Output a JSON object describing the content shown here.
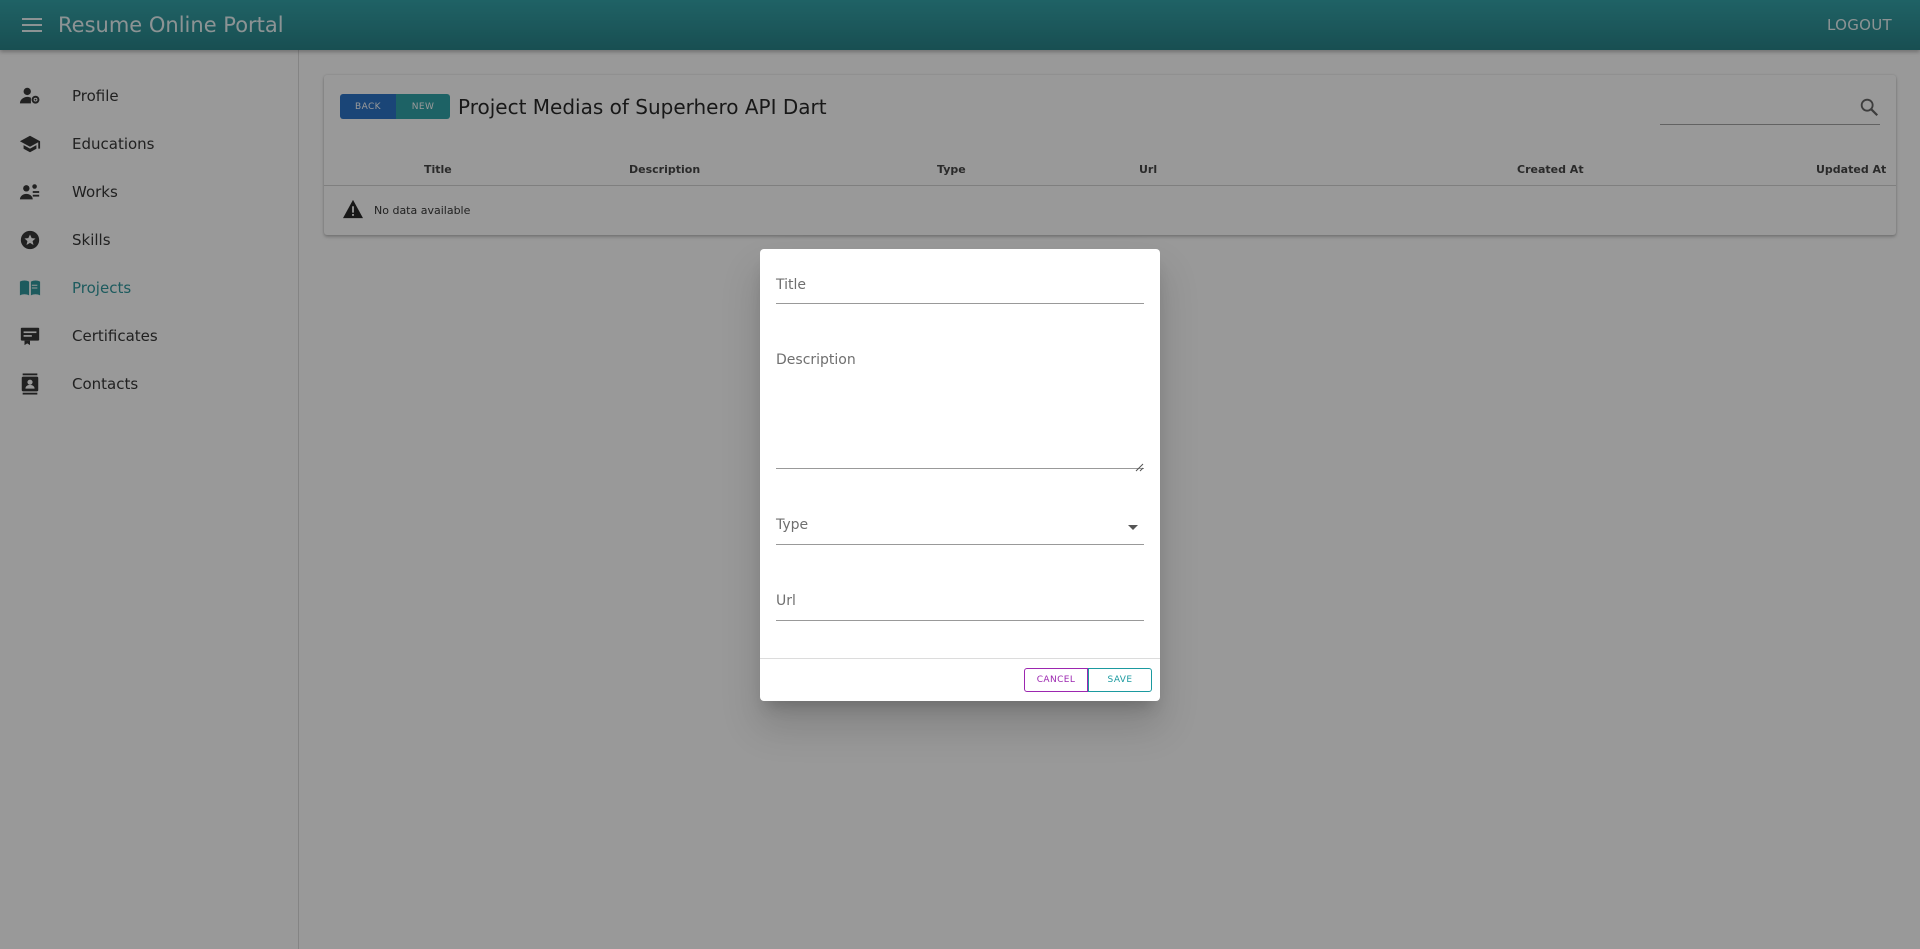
{
  "app": {
    "title": "Resume Online Portal",
    "logout_label": "LOGOUT",
    "menu_icon": "hamburger-menu-icon"
  },
  "sidebar": {
    "items": [
      {
        "label": "Profile",
        "icon": "user-cog-icon",
        "active": false
      },
      {
        "label": "Educations",
        "icon": "graduation-cap-icon",
        "active": false
      },
      {
        "label": "Works",
        "icon": "account-group-icon",
        "active": false
      },
      {
        "label": "Skills",
        "icon": "star-circle-icon",
        "active": false
      },
      {
        "label": "Projects",
        "icon": "book-open-icon",
        "active": true
      },
      {
        "label": "Certificates",
        "icon": "certificate-icon",
        "active": false
      },
      {
        "label": "Contacts",
        "icon": "contacts-icon",
        "active": false
      }
    ]
  },
  "main": {
    "back_label": "BACK",
    "new_label": "NEW",
    "title": "Project Medias of Superhero API Dart",
    "search_placeholder": "",
    "columns": [
      "Title",
      "Description",
      "Type",
      "Url",
      "Created At",
      "Updated At"
    ],
    "empty_text": "No data available"
  },
  "dialog": {
    "title_label": "Title",
    "title_value": "",
    "description_label": "Description",
    "description_value": "",
    "type_label": "Type",
    "type_value": "",
    "url_label": "Url",
    "url_value": "",
    "cancel_label": "CANCEL",
    "save_label": "SAVE"
  },
  "colors": {
    "primary": "#1b9aa0",
    "back_button": "#1565c0",
    "cancel": "#9c27b0",
    "active_nav": "#1b8c93"
  }
}
